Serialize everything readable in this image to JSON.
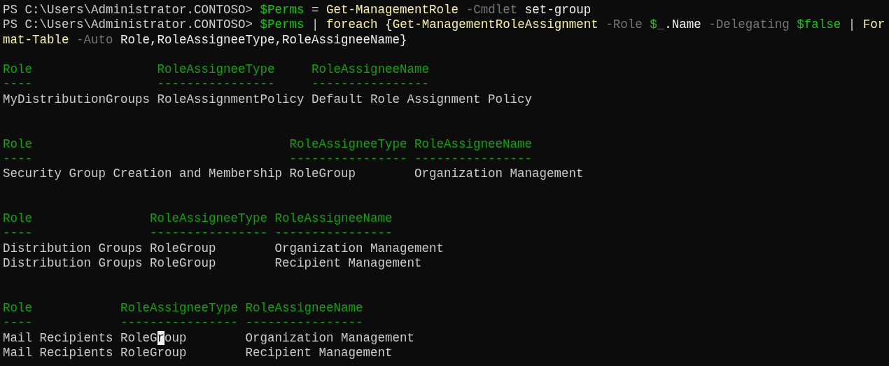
{
  "console": {
    "command_lines": [
      {
        "words": [
          [
            {
              "text": "PS C:\\Users\\Administrator.CONTOSO>",
              "kind": "prompt"
            }
          ],
          [
            {
              "text": "$Perms",
              "kind": "variable"
            }
          ],
          [
            {
              "text": "=",
              "kind": "operator"
            }
          ],
          [
            {
              "text": "Get-ManagementRole",
              "kind": "command"
            }
          ],
          [
            {
              "text": "-Cmdlet",
              "kind": "parameter"
            }
          ],
          [
            {
              "text": "set-group",
              "kind": "argument"
            }
          ]
        ]
      },
      {
        "words": [
          [
            {
              "text": "PS C:\\Users\\Administrator.CONTOSO>",
              "kind": "prompt"
            }
          ],
          [
            {
              "text": "$Perms",
              "kind": "variable"
            }
          ],
          [
            {
              "text": "|",
              "kind": "operator"
            }
          ],
          [
            {
              "text": "foreach",
              "kind": "command"
            }
          ],
          [
            {
              "text": "{",
              "kind": "argument"
            },
            {
              "text": "Get-ManagementRoleAssignment",
              "kind": "command"
            }
          ],
          [
            {
              "text": "-Role",
              "kind": "parameter"
            }
          ],
          [
            {
              "text": "$_",
              "kind": "variable"
            },
            {
              "text": ".Name",
              "kind": "argument"
            }
          ],
          [
            {
              "text": "-Delegating",
              "kind": "parameter"
            }
          ],
          [
            {
              "text": "$false",
              "kind": "variable"
            }
          ],
          [
            {
              "text": "|",
              "kind": "operator"
            }
          ],
          [
            {
              "text": "For",
              "kind": "command"
            }
          ]
        ]
      },
      {
        "words": [
          [
            {
              "text": "mat-Table",
              "kind": "command"
            }
          ],
          [
            {
              "text": "-Auto",
              "kind": "parameter"
            }
          ],
          [
            {
              "text": "Role,RoleAssigneeType,RoleAssigneeName}",
              "kind": "argument"
            }
          ]
        ]
      }
    ],
    "tables": [
      {
        "columns": [
          {
            "heading": "Role",
            "rule": "----"
          },
          {
            "heading": "RoleAssigneeType",
            "rule": "----------------"
          },
          {
            "heading": "RoleAssigneeName",
            "rule": "----------------"
          }
        ],
        "rows": [
          [
            "MyDistributionGroups",
            "RoleAssignmentPolicy",
            "Default Role Assignment Policy"
          ]
        ]
      },
      {
        "columns": [
          {
            "heading": "Role",
            "rule": "----"
          },
          {
            "heading": "RoleAssigneeType",
            "rule": "----------------"
          },
          {
            "heading": "RoleAssigneeName",
            "rule": "----------------"
          }
        ],
        "rows": [
          [
            "Security Group Creation and Membership",
            "RoleGroup",
            "Organization Management"
          ]
        ]
      },
      {
        "columns": [
          {
            "heading": "Role",
            "rule": "----"
          },
          {
            "heading": "RoleAssigneeType",
            "rule": "----------------"
          },
          {
            "heading": "RoleAssigneeName",
            "rule": "----------------"
          }
        ],
        "rows": [
          [
            "Distribution Groups",
            "RoleGroup",
            "Organization Management"
          ],
          [
            "Distribution Groups",
            "RoleGroup",
            "Recipient Management"
          ]
        ]
      },
      {
        "columns": [
          {
            "heading": "Role",
            "rule": "----"
          },
          {
            "heading": "RoleAssigneeType",
            "rule": "----------------"
          },
          {
            "heading": "RoleAssigneeName",
            "rule": "----------------"
          }
        ],
        "rows": [
          [
            "Mail Recipients",
            {
              "before": "RoleG",
              "cursor": "r",
              "after": "oup"
            },
            "Organization Management"
          ],
          [
            "Mail Recipients",
            "RoleGroup",
            "Recipient Management"
          ]
        ]
      }
    ]
  }
}
